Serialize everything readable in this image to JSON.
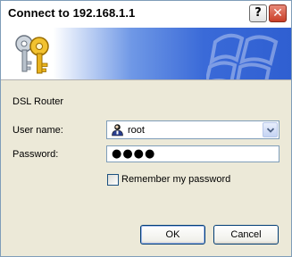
{
  "window": {
    "title": "Connect to 192.168.1.1",
    "help_label": "?",
    "close_label": "✕"
  },
  "banner": {
    "icon": "keys-icon",
    "logo": "windows-logo-watermark"
  },
  "realm": "DSL Router",
  "form": {
    "username_label": "User name:",
    "username_value": "root",
    "username_icon": "user-icon",
    "password_label": "Password:",
    "password_value": "●●●●",
    "remember_label": "Remember my password",
    "remember_checked": false
  },
  "buttons": {
    "ok": "OK",
    "cancel": "Cancel"
  },
  "colors": {
    "banner_blue": "#2f5fd1",
    "field_border": "#7f9db9",
    "dialog_bg": "#ece9d8"
  }
}
